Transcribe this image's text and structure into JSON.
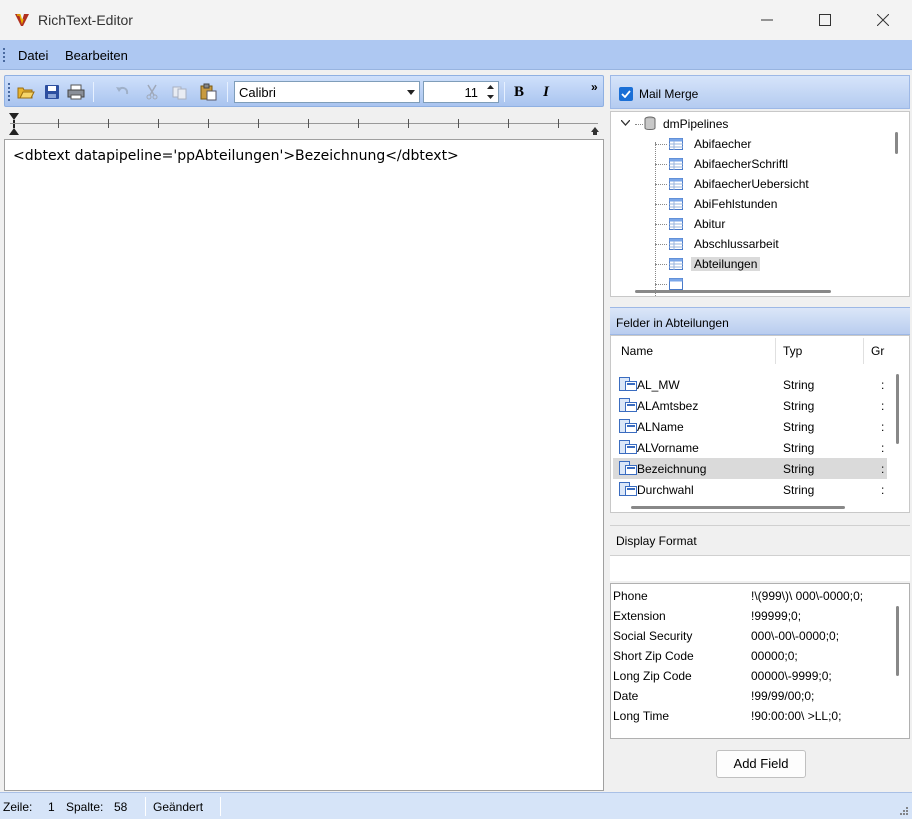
{
  "window": {
    "title": "RichText-Editor"
  },
  "menu": {
    "items": [
      "Datei",
      "Bearbeiten"
    ]
  },
  "toolbar": {
    "font": "Calibri",
    "size": "11",
    "bold_label": "B",
    "italic_label": "I",
    "overflow_label": "»",
    "icons": [
      "open-folder-icon",
      "save-icon",
      "print-icon",
      "undo-icon",
      "cut-icon",
      "copy-icon",
      "paste-icon"
    ]
  },
  "editor": {
    "content": "<dbtext datapipeline='ppAbteilungen'>Bezeichnung</dbtext>"
  },
  "mail_merge": {
    "label": "Mail Merge",
    "checked": true
  },
  "tree": {
    "root": "dmPipelines",
    "items": [
      "Abifaecher",
      "AbifaecherSchriftl",
      "AbifaecherUebersicht",
      "AbiFehlstunden",
      "Abitur",
      "Abschlussarbeit",
      "Abteilungen"
    ],
    "selected": "Abteilungen"
  },
  "felder": {
    "title": "Felder in Abteilungen",
    "columns": [
      "Name",
      "Typ",
      "Gr"
    ],
    "rows": [
      {
        "name": "AL_MW",
        "typ": "String"
      },
      {
        "name": "ALAmtsbez",
        "typ": "String"
      },
      {
        "name": "ALName",
        "typ": "String"
      },
      {
        "name": "ALVorname",
        "typ": "String"
      },
      {
        "name": "Bezeichnung",
        "typ": "String"
      },
      {
        "name": "Durchwahl",
        "typ": "String"
      }
    ],
    "selected": "Bezeichnung"
  },
  "display_format": {
    "title": "Display Format",
    "value": "",
    "formats": [
      {
        "name": "Phone",
        "format": "!\\(999\\)\\ 000\\-0000;0;"
      },
      {
        "name": "Extension",
        "format": "!99999;0;"
      },
      {
        "name": "Social Security",
        "format": "000\\-00\\-0000;0;"
      },
      {
        "name": "Short Zip Code",
        "format": "00000;0;"
      },
      {
        "name": "Long Zip Code",
        "format": "00000\\-9999;0;"
      },
      {
        "name": "Date",
        "format": "!99/99/00;0;"
      },
      {
        "name": "Long Time",
        "format": "!90:00:00\\ >LL;0;"
      }
    ]
  },
  "add_field_label": "Add Field",
  "status": {
    "zeile_label": "Zeile:",
    "zeile": "1",
    "spalte_label": "Spalte:",
    "spalte": "58",
    "state": "Geändert"
  },
  "colors": {
    "menubar": "#aec8f2",
    "accent": "#1a6fd6",
    "selected_row": "#dadada"
  }
}
